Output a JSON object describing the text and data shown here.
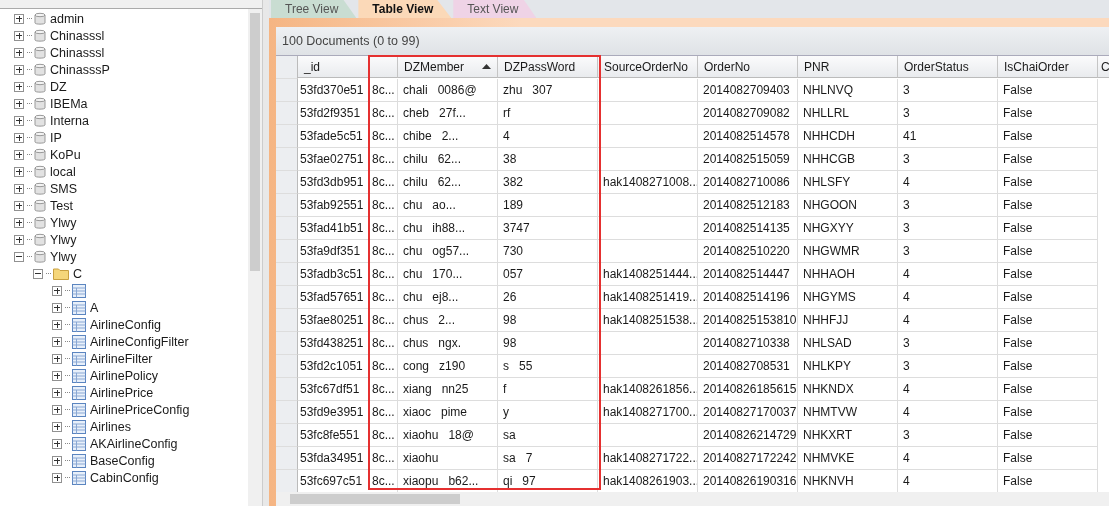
{
  "tree": [
    {
      "kind": "database",
      "label": "admin",
      "expanded": false
    },
    {
      "kind": "database",
      "label": "Chinasssl",
      "expanded": false
    },
    {
      "kind": "database",
      "label": "Chinasssl",
      "expanded": false
    },
    {
      "kind": "database",
      "label": "ChinasssP",
      "expanded": false
    },
    {
      "kind": "database",
      "label": "DZ",
      "expanded": false
    },
    {
      "kind": "database",
      "label": "IBEMa",
      "expanded": false
    },
    {
      "kind": "database",
      "label": "Interna",
      "expanded": false
    },
    {
      "kind": "database",
      "label": "IP",
      "expanded": false
    },
    {
      "kind": "database",
      "label": "KoPu",
      "expanded": false
    },
    {
      "kind": "database",
      "label": "local",
      "expanded": false
    },
    {
      "kind": "database",
      "label": "SMS",
      "expanded": false
    },
    {
      "kind": "database",
      "label": "Test",
      "expanded": false
    },
    {
      "kind": "database",
      "label": "Ylwy",
      "expanded": false
    },
    {
      "kind": "database",
      "label": "Ylwy",
      "expanded": false
    },
    {
      "kind": "database",
      "label": "Ylwy",
      "expanded": true,
      "children": [
        {
          "kind": "folder",
          "label": "C",
          "expanded": true,
          "children": [
            {
              "kind": "collection",
              "expanded": false
            },
            {
              "kind": "collection",
              "label": "A",
              "expanded": false
            },
            {
              "kind": "collection",
              "label": "AirlineConfig",
              "expanded": false
            },
            {
              "kind": "collection",
              "label": "AirlineConfigFilter",
              "expanded": false
            },
            {
              "kind": "collection",
              "label": "AirlineFilter",
              "expanded": false
            },
            {
              "kind": "collection",
              "label": "AirlinePolicy",
              "expanded": false
            },
            {
              "kind": "collection",
              "label": "AirlinePrice",
              "expanded": false
            },
            {
              "kind": "collection",
              "label": "AirlinePriceConfig",
              "expanded": false
            },
            {
              "kind": "collection",
              "label": "Airlines",
              "expanded": false
            },
            {
              "kind": "collection",
              "label": "AKAirlineConfig",
              "expanded": false
            },
            {
              "kind": "collection",
              "label": "BaseConfig",
              "expanded": false
            },
            {
              "kind": "collection",
              "label": "CabinConfig",
              "expanded": false
            }
          ]
        }
      ]
    }
  ],
  "tabs": [
    {
      "label": "Tree View",
      "selected": false,
      "color": "#c9ddd2"
    },
    {
      "label": "Table View",
      "selected": true,
      "color": "#fbd9b8"
    },
    {
      "label": "Text View",
      "selected": false,
      "color": "#efd3e6"
    }
  ],
  "summary": "100 Documents (0 to 99)",
  "table": {
    "columns": [
      {
        "label": "_id",
        "sorted": false
      },
      {
        "label": "DZMember",
        "sorted": true
      },
      {
        "label": "DZPassWord",
        "sorted": false
      },
      {
        "label": "SourceOrderNo",
        "sorted": false
      },
      {
        "label": "OrderNo",
        "sorted": false
      },
      {
        "label": "PNR",
        "sorted": false
      },
      {
        "label": "OrderStatus",
        "sorted": false
      },
      {
        "label": "IsChaiOrder",
        "sorted": false
      }
    ],
    "cut_column": {
      "label": "C"
    },
    "rows": [
      {
        "id": {
          "before": "53fd370e51",
          "after": "8c..."
        },
        "member": {
          "before": "chali",
          "after": "0086@"
        },
        "password": {
          "before": "zhu",
          "after": "307"
        },
        "order_no": "2014082709403",
        "pnr": "NHLNVQ",
        "status": "3",
        "is_chai": "False"
      },
      {
        "id": {
          "before": "53fd2f9351",
          "after": "8c..."
        },
        "member": {
          "before": "cheb",
          "after": "27f..."
        },
        "password": {
          "before": "rf"
        },
        "order_no": "2014082709082",
        "pnr": "NHLLRL",
        "status": "3",
        "is_chai": "False"
      },
      {
        "id": {
          "before": "53fade5c51",
          "after": "8c..."
        },
        "member": {
          "before": "chibe",
          "after": "2..."
        },
        "password": {
          "after": "4"
        },
        "order_no": "2014082514578",
        "pnr": "NHHCDH",
        "status": "41",
        "is_chai": "False"
      },
      {
        "id": {
          "before": "53fae02751",
          "after": "8c..."
        },
        "member": {
          "before": "chilu",
          "after": "62..."
        },
        "password": {
          "after": "38"
        },
        "order_no": "2014082515059",
        "pnr": "NHHCGB",
        "status": "3",
        "is_chai": "False"
      },
      {
        "id": {
          "before": "53fd3db951",
          "after": "8c..."
        },
        "member": {
          "before": "chilu",
          "after": "62..."
        },
        "password": {
          "after": "382"
        },
        "source": "hak1408271008...",
        "order_no": "2014082710086",
        "pnr": "NHLSFY",
        "status": "4",
        "is_chai": "False"
      },
      {
        "id": {
          "before": "53fab92551",
          "after": "8c..."
        },
        "member": {
          "before": "chu",
          "after": "ao..."
        },
        "password": {
          "after": "189"
        },
        "order_no": "2014082512183",
        "pnr": "NHGOON",
        "status": "3",
        "is_chai": "False"
      },
      {
        "id": {
          "before": "53fad41b51",
          "after": "8c..."
        },
        "member": {
          "before": "chu",
          "after": "ih88..."
        },
        "password": {
          "after": "3747"
        },
        "order_no": "2014082514135",
        "pnr": "NHGXYY",
        "status": "3",
        "is_chai": "False"
      },
      {
        "id": {
          "before": "53fa9df351",
          "after": "8c..."
        },
        "member": {
          "before": "chu",
          "after": "og57..."
        },
        "password": {
          "after": "730"
        },
        "order_no": "2014082510220",
        "pnr": "NHGWMR",
        "status": "3",
        "is_chai": "False"
      },
      {
        "id": {
          "before": "53fadb3c51",
          "after": "8c..."
        },
        "member": {
          "before": "chu",
          "after": "170..."
        },
        "password": {
          "after": "057"
        },
        "source": "hak1408251444...",
        "order_no": "2014082514447",
        "pnr": "NHHAOH",
        "status": "4",
        "is_chai": "False"
      },
      {
        "id": {
          "before": "53fad57651",
          "after": "8c..."
        },
        "member": {
          "before": "chu",
          "after": "ej8..."
        },
        "password": {
          "after": "26"
        },
        "source": "hak1408251419...",
        "order_no": "2014082514196",
        "pnr": "NHGYMS",
        "status": "4",
        "is_chai": "False"
      },
      {
        "id": {
          "before": "53fae80251",
          "after": "8c..."
        },
        "member": {
          "before": "chus",
          "after": "2..."
        },
        "password": {
          "after": "98"
        },
        "source": "hak1408251538...",
        "order_no": "20140825153810",
        "pnr": "NHHFJJ",
        "status": "4",
        "is_chai": "False"
      },
      {
        "id": {
          "before": "53fd438251",
          "after": "8c..."
        },
        "member": {
          "before": "chus",
          "after": "ngx."
        },
        "password": {
          "after": "98"
        },
        "order_no": "2014082710338",
        "pnr": "NHLSAD",
        "status": "3",
        "is_chai": "False"
      },
      {
        "id": {
          "before": "53fd2c1051",
          "after": "8c..."
        },
        "member": {
          "before": "cong",
          "after": "z190"
        },
        "password": {
          "before": "s",
          "after": "55"
        },
        "order_no": "2014082708531",
        "pnr": "NHLKPY",
        "status": "3",
        "is_chai": "False"
      },
      {
        "id": {
          "before": "53fc67df51",
          "after": "8c..."
        },
        "member": {
          "before": "xiang",
          "after": "nn25"
        },
        "password": {
          "before": "f"
        },
        "source": "hak1408261856...",
        "order_no": "20140826185615",
        "pnr": "NHKNDX",
        "status": "4",
        "is_chai": "False"
      },
      {
        "id": {
          "before": "53fd9e3951",
          "after": "8c..."
        },
        "member": {
          "before": "xiaoc",
          "after": "pime"
        },
        "password": {
          "before": "y"
        },
        "source": "hak1408271700...",
        "order_no": "20140827170037",
        "pnr": "NHMTVW",
        "status": "4",
        "is_chai": "False"
      },
      {
        "id": {
          "before": "53fc8fe551",
          "after": "8c..."
        },
        "member": {
          "before": "xiaohu",
          "after": "18@"
        },
        "password": {
          "before": "sa"
        },
        "order_no": "20140826214729",
        "pnr": "NHKXRT",
        "status": "3",
        "is_chai": "False"
      },
      {
        "id": {
          "before": "53fda34951",
          "after": "8c..."
        },
        "member": {
          "before": "xiaohu"
        },
        "password": {
          "before": "sa",
          "after": "7"
        },
        "source": "hak1408271722...",
        "order_no": "20140827172242",
        "pnr": "NHMVKE",
        "status": "4",
        "is_chai": "False"
      },
      {
        "id": {
          "before": "53fc697c51",
          "after": "8c..."
        },
        "member": {
          "before": "xiaopu",
          "after": "b62..."
        },
        "password": {
          "before": "qi",
          "after": "97"
        },
        "source": "hak1408261903...",
        "order_no": "20140826190316",
        "pnr": "NHKNVH",
        "status": "4",
        "is_chai": "False"
      }
    ]
  }
}
